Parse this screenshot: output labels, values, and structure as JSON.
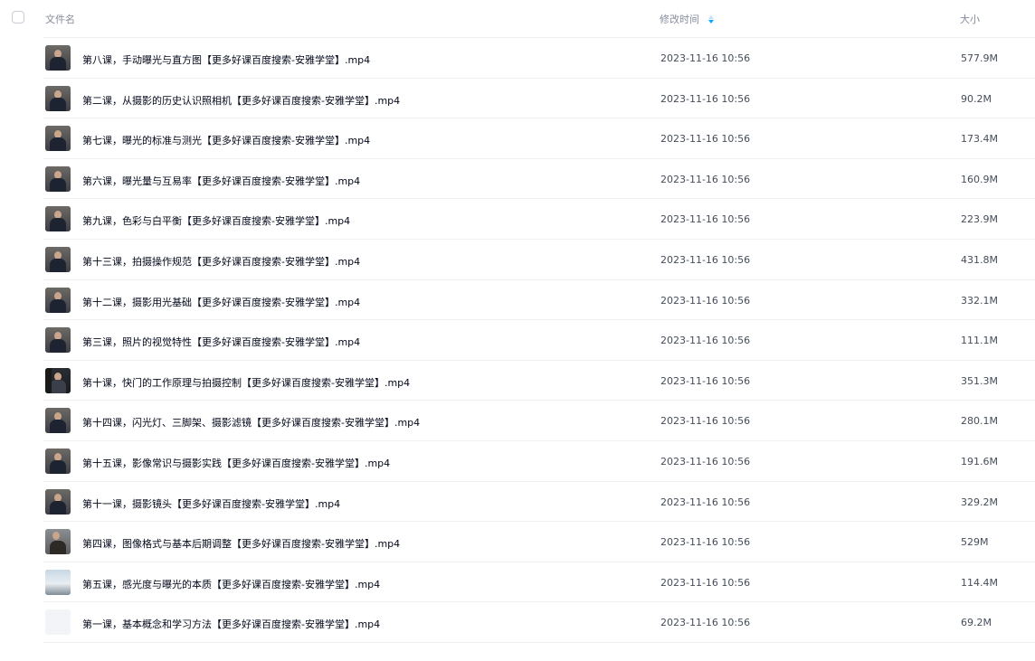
{
  "header": {
    "name_label": "文件名",
    "time_label": "修改时间",
    "size_label": "大小",
    "sort_icon": "sort-descending-icon"
  },
  "files": [
    {
      "name": "第八课，手动曝光与直方图【更多好课百度搜索-安雅学堂】.mp4",
      "time": "2023-11-16 10:56",
      "size": "577.9M",
      "thumb": "person"
    },
    {
      "name": "第二课，从摄影的历史认识照相机【更多好课百度搜索-安雅学堂】.mp4",
      "time": "2023-11-16 10:56",
      "size": "90.2M",
      "thumb": "person"
    },
    {
      "name": "第七课，曝光的标准与测光【更多好课百度搜索-安雅学堂】.mp4",
      "time": "2023-11-16 10:56",
      "size": "173.4M",
      "thumb": "person"
    },
    {
      "name": "第六课，曝光量与互易率【更多好课百度搜索-安雅学堂】.mp4",
      "time": "2023-11-16 10:56",
      "size": "160.9M",
      "thumb": "person"
    },
    {
      "name": "第九课，色彩与白平衡【更多好课百度搜索-安雅学堂】.mp4",
      "time": "2023-11-16 10:56",
      "size": "223.9M",
      "thumb": "person"
    },
    {
      "name": "第十三课，拍摄操作规范【更多好课百度搜索-安雅学堂】.mp4",
      "time": "2023-11-16 10:56",
      "size": "431.8M",
      "thumb": "person"
    },
    {
      "name": "第十二课，摄影用光基础【更多好课百度搜索-安雅学堂】.mp4",
      "time": "2023-11-16 10:56",
      "size": "332.1M",
      "thumb": "person"
    },
    {
      "name": "第三课，照片的视觉特性【更多好课百度搜索-安雅学堂】.mp4",
      "time": "2023-11-16 10:56",
      "size": "111.1M",
      "thumb": "person"
    },
    {
      "name": "第十课，快门的工作原理与拍摄控制【更多好课百度搜索-安雅学堂】.mp4",
      "time": "2023-11-16 10:56",
      "size": "351.3M",
      "thumb": "dark"
    },
    {
      "name": "第十四课，闪光灯、三脚架、摄影滤镜【更多好课百度搜索-安雅学堂】.mp4",
      "time": "2023-11-16 10:56",
      "size": "280.1M",
      "thumb": "person"
    },
    {
      "name": "第十五课，影像常识与摄影实践【更多好课百度搜索-安雅学堂】.mp4",
      "time": "2023-11-16 10:56",
      "size": "191.6M",
      "thumb": "person"
    },
    {
      "name": "第十一课，摄影镜头【更多好课百度搜索-安雅学堂】.mp4",
      "time": "2023-11-16 10:56",
      "size": "329.2M",
      "thumb": "person"
    },
    {
      "name": "第四课，图像格式与基本后期调整【更多好课百度搜索-安雅学堂】.mp4",
      "time": "2023-11-16 10:56",
      "size": "529M",
      "thumb": "alt"
    },
    {
      "name": "第五课，感光度与曝光的本质【更多好课百度搜索-安雅学堂】.mp4",
      "time": "2023-11-16 10:56",
      "size": "114.4M",
      "thumb": "sky"
    },
    {
      "name": "第一课，基本概念和学习方法【更多好课百度搜索-安雅学堂】.mp4",
      "time": "2023-11-16 10:56",
      "size": "69.2M",
      "thumb": "blank"
    }
  ]
}
